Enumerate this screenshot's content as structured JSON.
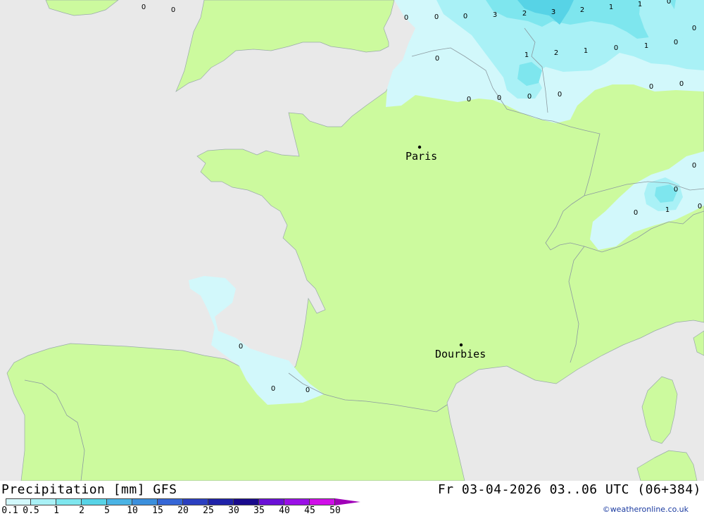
{
  "map": {
    "cities": [
      {
        "name": "Paris"
      },
      {
        "name": "Dourbies"
      }
    ],
    "grid_values": [
      "0",
      "0",
      "0",
      "0",
      "0",
      "3",
      "2",
      "3",
      "2",
      "1",
      "1",
      "0",
      "0",
      "1",
      "2",
      "1",
      "0",
      "1",
      "0",
      "0",
      "0",
      "0",
      "0",
      "0",
      "0",
      "0",
      "0",
      "0",
      "1",
      "0",
      "0",
      "0",
      "0",
      "0"
    ],
    "colors": {
      "sea": "#e9e9e9",
      "land": "#ccfa9e",
      "precip_0_1": "#d2f8fb",
      "precip_0_5": "#a9f1f6",
      "precip_1": "#7ee6ee",
      "precip_2": "#57d3e6"
    }
  },
  "footer": {
    "title": "Precipitation [mm] GFS",
    "timestamp": "Fr 03-04-2026 03..06 UTC (06+384)",
    "credit": "©weatheronline.co.uk",
    "legend": [
      {
        "label": "0.1",
        "color": "#d2f8fb"
      },
      {
        "label": "0.5",
        "color": "#a9f1f6"
      },
      {
        "label": "1",
        "color": "#7ee6ee"
      },
      {
        "label": "2",
        "color": "#57d3e6"
      },
      {
        "label": "5",
        "color": "#4ab3e4"
      },
      {
        "label": "10",
        "color": "#3b8fdc"
      },
      {
        "label": "15",
        "color": "#3566d6"
      },
      {
        "label": "20",
        "color": "#2b3fc0"
      },
      {
        "label": "25",
        "color": "#1f22a8"
      },
      {
        "label": "30",
        "color": "#190a8c"
      },
      {
        "label": "35",
        "color": "#6a10d6"
      },
      {
        "label": "40",
        "color": "#9a10e6"
      },
      {
        "label": "45",
        "color": "#d00ee8"
      },
      {
        "label": "50",
        "color": "#b40ab4"
      }
    ],
    "arrow_color": "#a000b8"
  }
}
